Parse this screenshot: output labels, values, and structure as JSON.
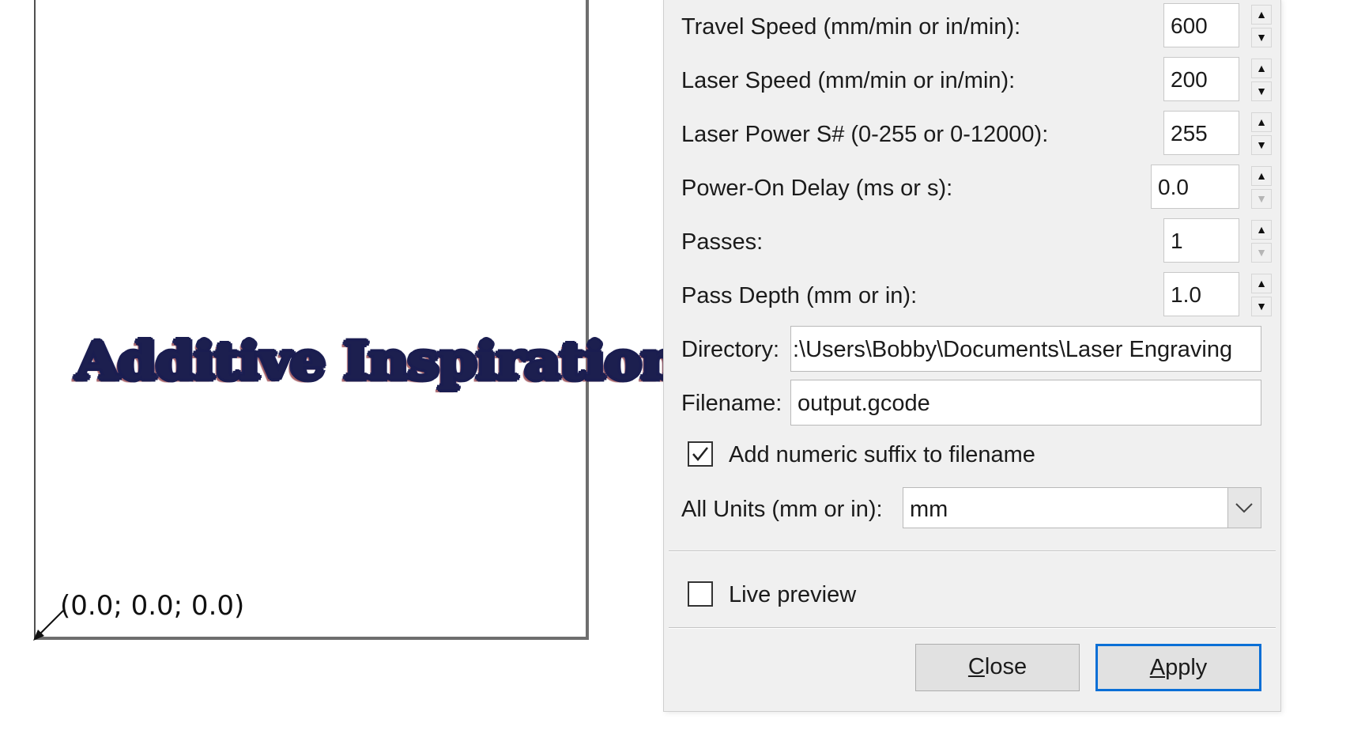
{
  "canvas": {
    "artwork_text": "Additive Inspiration",
    "origin_label": "(0.0; 0.0; 0.0)"
  },
  "dialog": {
    "fields": [
      {
        "label": "Travel Speed (mm/min or in/min):",
        "value": "600",
        "down_disabled": false
      },
      {
        "label": "Laser Speed (mm/min or in/min):",
        "value": "200",
        "down_disabled": false
      },
      {
        "label": "Laser Power S# (0-255 or 0-12000):",
        "value": "255",
        "down_disabled": false
      },
      {
        "label": "Power-On Delay (ms or s):",
        "value": "0.0",
        "down_disabled": true
      },
      {
        "label": "Passes:",
        "value": "1",
        "down_disabled": true
      },
      {
        "label": "Pass Depth (mm or in):",
        "value": "1.0",
        "down_disabled": false
      }
    ],
    "directory": {
      "label": "Directory:",
      "value": ":\\Users\\Bobby\\Documents\\Laser Engraving"
    },
    "filename": {
      "label": "Filename:",
      "value": "output.gcode"
    },
    "numeric_suffix": {
      "label": "Add numeric suffix to filename",
      "checked": true
    },
    "units": {
      "label": "All Units (mm or in):",
      "value": "mm"
    },
    "live_preview": {
      "label": "Live preview",
      "checked": false
    },
    "buttons": {
      "close_accel": "C",
      "close_rest": "lose",
      "apply_accel": "A",
      "apply_rest": "pply"
    }
  },
  "icons": {
    "spin_up": "up-arrow-icon",
    "spin_down": "down-arrow-icon",
    "combo": "chevron-down-icon",
    "check": "checkmark-icon",
    "origin": "arrow-icon"
  }
}
